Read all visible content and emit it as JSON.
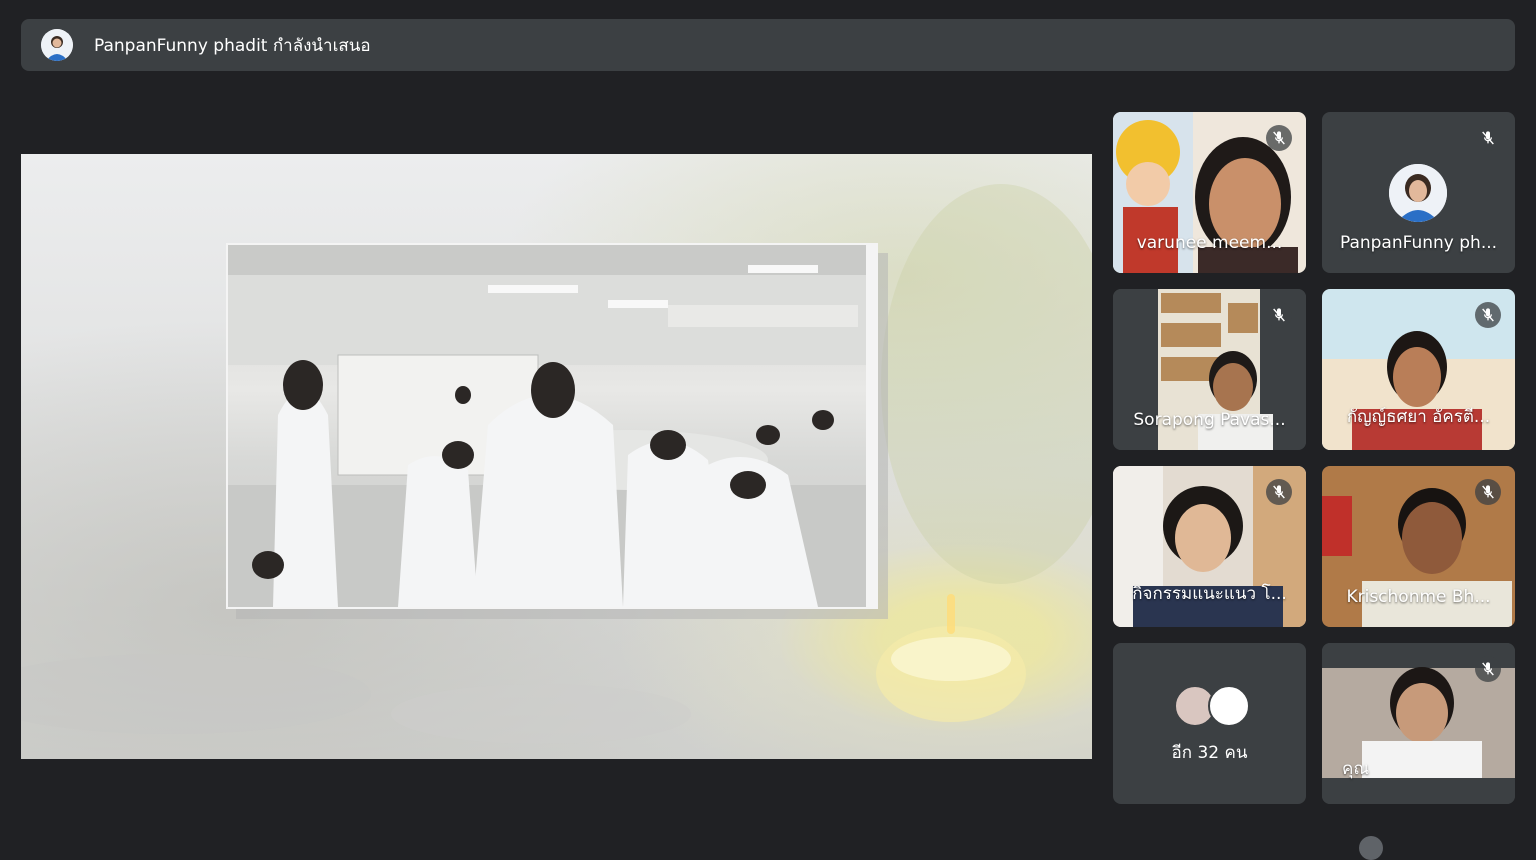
{
  "presenter_bar": {
    "text": "PanpanFunny phadit กำลังนำเสนอ"
  },
  "participants": [
    {
      "name": "varunee meem...",
      "muted": true,
      "video": true
    },
    {
      "name": "PanpanFunny ph...",
      "muted": true,
      "video": false
    },
    {
      "name": "Sorapong Pavas...",
      "muted": true,
      "video": true
    },
    {
      "name": "กัญญ์ธศยา อัครตี...",
      "muted": true,
      "video": true
    },
    {
      "name": "กิจกรรมแนะแนว โ...",
      "muted": true,
      "video": true
    },
    {
      "name": "Krischonme Bh...",
      "muted": true,
      "video": true
    },
    {
      "name": "คุณ",
      "muted": true,
      "video": true
    }
  ],
  "more_participants": {
    "label": "อีก 32 คน"
  },
  "icons": {
    "mic": "mic-off-icon",
    "presenter": "presenter-avatar-icon"
  }
}
